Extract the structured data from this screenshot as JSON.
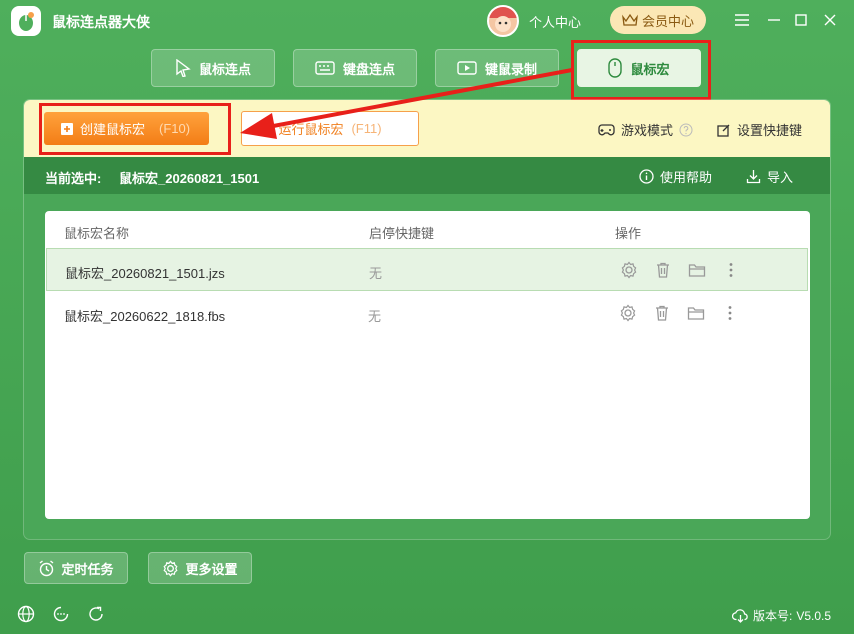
{
  "app": {
    "title": "鼠标连点器大侠"
  },
  "header": {
    "personal_label": "个人中心",
    "vip_label": "会员中心"
  },
  "tabs": [
    {
      "label": "鼠标连点"
    },
    {
      "label": "键盘连点"
    },
    {
      "label": "键鼠录制"
    },
    {
      "label": "鼠标宏"
    }
  ],
  "toolbar": {
    "create_label": "创建鼠标宏",
    "create_key": "(F10)",
    "run_label": "运行鼠标宏",
    "run_key": "(F11)",
    "game_mode": "游戏模式",
    "shortcut_settings": "设置快捷键"
  },
  "current": {
    "label": "当前选中:",
    "value": "鼠标宏_20260821_1501",
    "help": "使用帮助",
    "import": "导入"
  },
  "table": {
    "headers": [
      "鼠标宏名称",
      "启停快捷键",
      "操作"
    ],
    "rows": [
      {
        "name": "鼠标宏_20260821_1501.jzs",
        "hotkey": "无"
      },
      {
        "name": "鼠标宏_20260622_1818.fbs",
        "hotkey": "无"
      }
    ]
  },
  "footer": {
    "timer_task": "定时任务",
    "more_settings": "更多设置",
    "version_label": "版本号:",
    "version_value": "V5.0.5"
  },
  "colors": {
    "brand_green": "#4faf5c",
    "dark_green": "#358a43",
    "accent_orange": "#f37d16",
    "highlight_red": "#e8201a",
    "toolbar_yellow": "#fcf7c3"
  }
}
